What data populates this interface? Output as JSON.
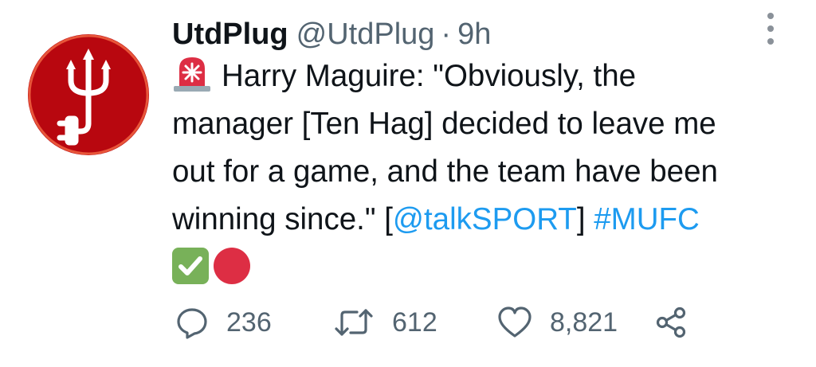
{
  "tweet": {
    "display_name": "UtdPlug",
    "handle": "@UtdPlug",
    "separator": "·",
    "time": "9h",
    "text_lines": [
      {
        "segments": [
          {
            "t": "Harry Maguire: \"Obviously, the",
            "link": false
          }
        ]
      },
      {
        "segments": [
          {
            "t": "manager [Ten Hag] decided to leave me",
            "link": false
          }
        ]
      },
      {
        "segments": [
          {
            "t": "out for a game, and the team have been",
            "link": false
          }
        ]
      },
      {
        "segments": [
          {
            "t": "winning since.\" [",
            "link": false
          },
          {
            "t": "@talkSPORT",
            "link": true
          },
          {
            "t": "] ",
            "link": false
          },
          {
            "t": "#MUFC",
            "link": true
          }
        ]
      }
    ],
    "emojis": [
      "siren-emoji",
      "check-mark-emoji",
      "red-circle-emoji"
    ]
  },
  "actions": {
    "reply_count": "236",
    "retweet_count": "612",
    "like_count": "8,821"
  },
  "colors": {
    "link": "#1d9bf0",
    "muted": "#536471",
    "avatar_bg": "#b8070f",
    "avatar_ring": "#e8563a"
  }
}
